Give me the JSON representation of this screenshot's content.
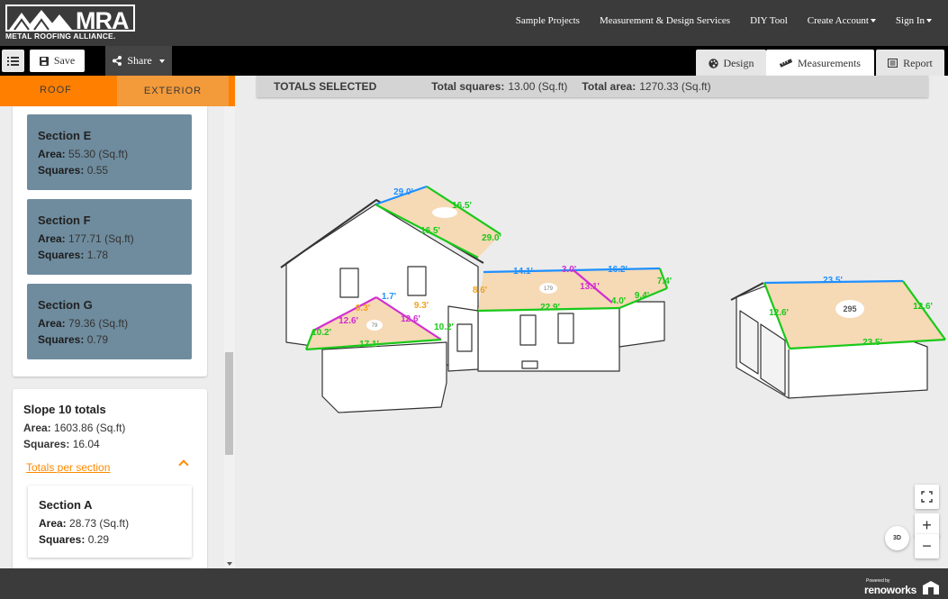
{
  "app": {
    "logo_text": "MRA",
    "logo_sub": "METAL ROOFING ALLIANCE."
  },
  "nav": {
    "links": [
      "Sample Projects",
      "Measurement & Design Services",
      "DIY Tool",
      "Create Account",
      "Sign In"
    ]
  },
  "toolbar": {
    "save_label": "Save",
    "share_label": "Share",
    "tabs": [
      "Design",
      "Measurements",
      "Report"
    ],
    "active_tab": "Measurements"
  },
  "left_panel": {
    "tabs": [
      "ROOF",
      "EXTERIOR"
    ],
    "active_tab": "ROOF",
    "sections": [
      {
        "title": "Section E",
        "area": "55.30 (Sq.ft)",
        "squares": "0.55"
      },
      {
        "title": "Section F",
        "area": "177.71 (Sq.ft)",
        "squares": "1.78"
      },
      {
        "title": "Section G",
        "area": "79.36 (Sq.ft)",
        "squares": "0.79"
      }
    ],
    "area_label": "Area:",
    "squares_label": "Squares:",
    "slope_totals": {
      "title": "Slope 10 totals",
      "area": "1603.86 (Sq.ft)",
      "squares": "16.04",
      "link": "Totals per section"
    },
    "section_a": {
      "title": "Section A",
      "area": "28.73 (Sq.ft)",
      "squares": "0.29"
    }
  },
  "totals_bar": {
    "label": "TOTALS SELECTED",
    "squares_label": "Total squares:",
    "squares_value": "13.00 (Sq.ft)",
    "area_label": "Total area:",
    "area_value": "1270.33 (Sq.ft)"
  },
  "measurements": {
    "upper": [
      "29.0'",
      "16.5'",
      "16.5'",
      "29.0'"
    ],
    "middle": [
      "14.1'",
      "3.0'",
      "16.2'",
      "13.1'",
      "7.4'",
      "4.0'",
      "9.4'",
      "22.9'",
      "8.6'"
    ],
    "left": [
      "1.7'",
      "9.3'",
      "9.3'",
      "12.6'",
      "12.6'",
      "10.2'",
      "10.2'",
      "17.1'"
    ],
    "garage": [
      "23.5'",
      "12.6'",
      "12.6'",
      "23.5'"
    ],
    "roof_tags": [
      "295",
      "179",
      "79"
    ]
  },
  "controls": {
    "threed": "3D",
    "zoom_in": "+",
    "zoom_out": "−"
  },
  "footer": {
    "powered": "Powered by",
    "brand": "renoworks"
  },
  "colors": {
    "nav_bg": "#3b3b3b",
    "accent_orange": "#ff7f00",
    "section_card": "#6f8c9e",
    "roof_fill": "#f6d9b5",
    "measure_green": "#19c919",
    "measure_blue": "#1e90ff",
    "measure_magenta": "#d12ed1",
    "measure_orange": "#f0a020"
  }
}
